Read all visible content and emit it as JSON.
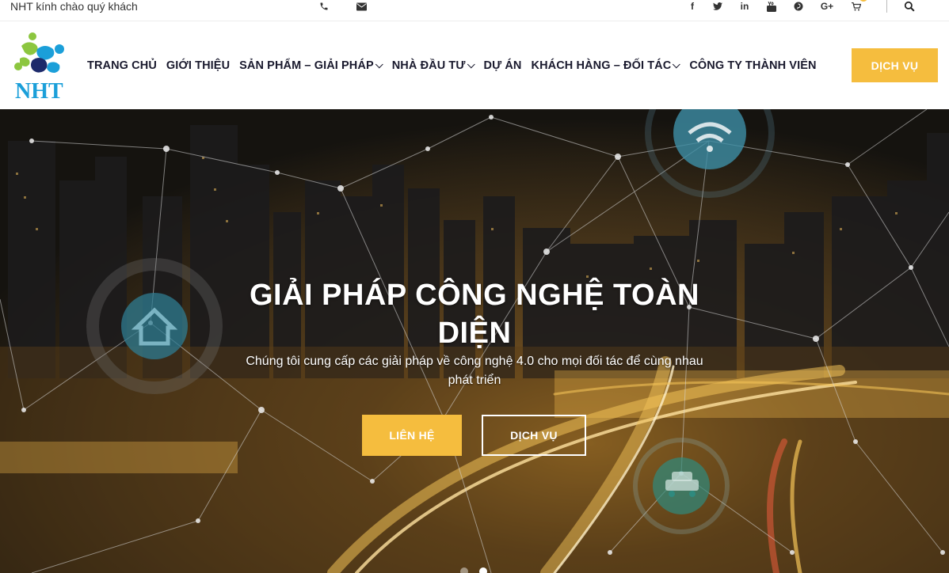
{
  "topbar": {
    "greeting": "NHT kính chào quý khách",
    "contact_icons": [
      "phone-icon",
      "envelope-icon"
    ],
    "social_icons": [
      "facebook-icon",
      "twitter-icon",
      "linkedin-icon",
      "youtube-icon",
      "pinterest-icon",
      "google-plus-icon",
      "cart-icon",
      "search-icon"
    ],
    "social_glyphs": {
      "facebook": "f",
      "linkedin": "in",
      "google_plus": "G+"
    }
  },
  "header": {
    "logo_text": "NHT",
    "nav": [
      {
        "label": "TRANG CHỦ",
        "has_dropdown": false
      },
      {
        "label": "GIỚI THIỆU",
        "has_dropdown": false
      },
      {
        "label": "SẢN PHẨM – GIẢI PHÁP",
        "has_dropdown": true
      },
      {
        "label": "NHÀ ĐẦU TƯ",
        "has_dropdown": true
      },
      {
        "label": "DỰ ÁN",
        "has_dropdown": false
      },
      {
        "label": "KHÁCH HÀNG – ĐỐI TÁC",
        "has_dropdown": true
      },
      {
        "label": "CÔNG TY THÀNH VIÊN",
        "has_dropdown": false
      }
    ],
    "cta_label": "DỊCH VỤ"
  },
  "hero": {
    "title": "GIẢI PHÁP CÔNG NGHỆ TOÀN DIỆN",
    "subtitle": "Chúng tôi cung cấp các giải pháp về công nghệ 4.0 cho mọi đối tác để cùng nhau phát triển",
    "primary_button": "LIÊN HỆ",
    "secondary_button": "DỊCH VỤ",
    "slide_count": 2,
    "active_slide": 2
  },
  "colors": {
    "accent": "#f5bd3e",
    "nav_text": "#1a1a2e",
    "logo_blue": "#1b9fd9",
    "logo_green": "#8cc63f",
    "logo_navy": "#1d2a6b"
  }
}
